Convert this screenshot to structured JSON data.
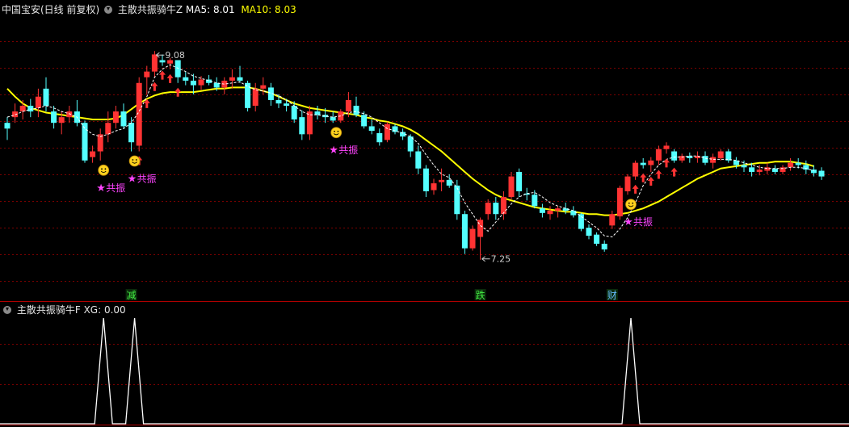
{
  "top_header": {
    "stock": "中国宝安(日线 前复权)",
    "indicator": "主散共振骑牛Z",
    "ma5_label": "MA5: 8.01",
    "ma10_label": "MA10: 8.03"
  },
  "bottom_header": {
    "indicator": "主散共振骑牛F",
    "xg_label": "XG: 0.00"
  },
  "colors": {
    "up": "#ff3333",
    "down": "#54ffff",
    "ma10": "#ffff00",
    "ma5": "#ffffff",
    "signal": "#ff44ff",
    "grid": "#7a0000"
  },
  "chart_data": [
    {
      "type": "candlestick",
      "ohlc": [
        [
          8.45,
          8.5,
          8.3,
          8.4
        ],
        [
          8.5,
          8.62,
          8.45,
          8.55
        ],
        [
          8.55,
          8.65,
          8.48,
          8.6
        ],
        [
          8.6,
          8.66,
          8.5,
          8.55
        ],
        [
          8.58,
          8.75,
          8.5,
          8.68
        ],
        [
          8.75,
          8.85,
          8.55,
          8.6
        ],
        [
          8.55,
          8.6,
          8.4,
          8.45
        ],
        [
          8.45,
          8.55,
          8.35,
          8.5
        ],
        [
          8.5,
          8.6,
          8.45,
          8.55
        ],
        [
          8.55,
          8.65,
          8.42,
          8.45
        ],
        [
          8.45,
          8.47,
          8.1,
          8.12
        ],
        [
          8.15,
          8.25,
          8.1,
          8.2
        ],
        [
          8.2,
          8.4,
          8.12,
          8.35
        ],
        [
          8.35,
          8.55,
          8.28,
          8.45
        ],
        [
          8.45,
          8.6,
          8.4,
          8.55
        ],
        [
          8.55,
          8.62,
          8.4,
          8.42
        ],
        [
          8.45,
          8.5,
          8.2,
          8.28
        ],
        [
          8.25,
          8.85,
          8.2,
          8.8
        ],
        [
          8.85,
          8.95,
          8.7,
          8.9
        ],
        [
          8.9,
          9.08,
          8.85,
          9.05
        ],
        [
          9.0,
          9.05,
          8.95,
          8.98
        ],
        [
          8.97,
          9.02,
          8.92,
          9.0
        ],
        [
          9.0,
          9.0,
          8.8,
          8.85
        ],
        [
          8.85,
          8.9,
          8.78,
          8.82
        ],
        [
          8.82,
          8.88,
          8.7,
          8.78
        ],
        [
          8.78,
          8.86,
          8.74,
          8.83
        ],
        [
          8.83,
          8.87,
          8.78,
          8.8
        ],
        [
          8.8,
          8.85,
          8.73,
          8.76
        ],
        [
          8.76,
          8.85,
          8.7,
          8.82
        ],
        [
          8.82,
          8.92,
          8.75,
          8.85
        ],
        [
          8.85,
          8.95,
          8.8,
          8.82
        ],
        [
          8.8,
          8.82,
          8.55,
          8.58
        ],
        [
          8.6,
          8.8,
          8.55,
          8.75
        ],
        [
          8.75,
          8.85,
          8.7,
          8.78
        ],
        [
          8.76,
          8.8,
          8.6,
          8.65
        ],
        [
          8.65,
          8.7,
          8.58,
          8.62
        ],
        [
          8.62,
          8.66,
          8.55,
          8.6
        ],
        [
          8.6,
          8.64,
          8.45,
          8.48
        ],
        [
          8.5,
          8.56,
          8.3,
          8.35
        ],
        [
          8.35,
          8.6,
          8.3,
          8.55
        ],
        [
          8.55,
          8.6,
          8.48,
          8.52
        ],
        [
          8.52,
          8.58,
          8.45,
          8.5
        ],
        [
          8.5,
          8.55,
          8.45,
          8.47
        ],
        [
          8.47,
          8.57,
          8.45,
          8.55
        ],
        [
          8.55,
          8.72,
          8.5,
          8.65
        ],
        [
          8.6,
          8.68,
          8.5,
          8.52
        ],
        [
          8.52,
          8.55,
          8.4,
          8.42
        ],
        [
          8.42,
          8.48,
          8.35,
          8.38
        ],
        [
          8.36,
          8.4,
          8.25,
          8.28
        ],
        [
          8.3,
          8.46,
          8.28,
          8.44
        ],
        [
          8.42,
          8.44,
          8.35,
          8.37
        ],
        [
          8.37,
          8.4,
          8.3,
          8.33
        ],
        [
          8.33,
          8.35,
          8.15,
          8.2
        ],
        [
          8.2,
          8.25,
          8.0,
          8.05
        ],
        [
          8.05,
          8.08,
          7.8,
          7.85
        ],
        [
          7.86,
          7.96,
          7.82,
          7.92
        ],
        [
          7.93,
          8.05,
          7.85,
          7.95
        ],
        [
          7.95,
          8.0,
          7.88,
          7.9
        ],
        [
          7.9,
          7.95,
          7.6,
          7.65
        ],
        [
          7.65,
          7.68,
          7.3,
          7.35
        ],
        [
          7.35,
          7.55,
          7.33,
          7.52
        ],
        [
          7.45,
          7.62,
          7.25,
          7.6
        ],
        [
          7.65,
          7.78,
          7.6,
          7.75
        ],
        [
          7.75,
          7.8,
          7.6,
          7.65
        ],
        [
          7.65,
          7.85,
          7.6,
          7.8
        ],
        [
          7.8,
          8.02,
          7.78,
          7.98
        ],
        [
          8.02,
          8.05,
          7.8,
          7.85
        ],
        [
          7.83,
          7.88,
          7.77,
          7.82
        ],
        [
          7.82,
          7.86,
          7.7,
          7.72
        ],
        [
          7.7,
          7.74,
          7.62,
          7.66
        ],
        [
          7.65,
          7.72,
          7.6,
          7.68
        ],
        [
          7.68,
          7.72,
          7.62,
          7.7
        ],
        [
          7.7,
          7.75,
          7.65,
          7.68
        ],
        [
          7.68,
          7.72,
          7.62,
          7.64
        ],
        [
          7.65,
          7.66,
          7.5,
          7.52
        ],
        [
          7.53,
          7.56,
          7.43,
          7.46
        ],
        [
          7.47,
          7.49,
          7.37,
          7.39
        ],
        [
          7.39,
          7.42,
          7.32,
          7.34
        ],
        [
          7.55,
          7.68,
          7.52,
          7.65
        ],
        [
          7.63,
          7.9,
          7.6,
          7.88
        ],
        [
          7.85,
          8.0,
          7.82,
          7.98
        ],
        [
          7.98,
          8.12,
          7.95,
          8.1
        ],
        [
          8.1,
          8.14,
          8.05,
          8.08
        ],
        [
          8.08,
          8.15,
          8.02,
          8.12
        ],
        [
          8.12,
          8.25,
          8.08,
          8.22
        ],
        [
          8.22,
          8.28,
          8.18,
          8.25
        ],
        [
          8.2,
          8.22,
          8.1,
          8.12
        ],
        [
          8.12,
          8.18,
          8.1,
          8.16
        ],
        [
          8.16,
          8.19,
          8.1,
          8.14
        ],
        [
          8.14,
          8.2,
          8.1,
          8.16
        ],
        [
          8.16,
          8.2,
          8.08,
          8.1
        ],
        [
          8.1,
          8.18,
          8.05,
          8.15
        ],
        [
          8.14,
          8.22,
          8.12,
          8.2
        ],
        [
          8.2,
          8.22,
          8.1,
          8.12
        ],
        [
          8.12,
          8.15,
          8.05,
          8.08
        ],
        [
          8.08,
          8.12,
          8.02,
          8.06
        ],
        [
          8.06,
          8.1,
          7.98,
          8.02
        ],
        [
          8.02,
          8.08,
          7.99,
          8.04
        ],
        [
          8.03,
          8.1,
          8.0,
          8.06
        ],
        [
          8.05,
          8.08,
          8.0,
          8.02
        ],
        [
          8.02,
          8.08,
          8.0,
          8.06
        ],
        [
          8.06,
          8.14,
          8.03,
          8.1
        ],
        [
          8.1,
          8.14,
          8.05,
          8.08
        ],
        [
          8.08,
          8.12,
          8.0,
          8.04
        ],
        [
          8.04,
          8.08,
          7.98,
          8.01
        ],
        [
          8.03,
          8.06,
          7.95,
          7.98
        ]
      ],
      "ma10": [
        8.75,
        8.68,
        8.62,
        8.58,
        8.56,
        8.54,
        8.53,
        8.52,
        8.51,
        8.5,
        8.49,
        8.48,
        8.48,
        8.48,
        8.49,
        8.52,
        8.57,
        8.62,
        8.66,
        8.69,
        8.71,
        8.72,
        8.72,
        8.72,
        8.72,
        8.73,
        8.74,
        8.75,
        8.75,
        8.76,
        8.76,
        8.76,
        8.75,
        8.73,
        8.71,
        8.68,
        8.65,
        8.62,
        8.6,
        8.58,
        8.57,
        8.56,
        8.55,
        8.54,
        8.53,
        8.52,
        8.5,
        8.49,
        8.47,
        8.46,
        8.44,
        8.42,
        8.39,
        8.35,
        8.3,
        8.25,
        8.2,
        8.14,
        8.08,
        8.02,
        7.96,
        7.91,
        7.86,
        7.82,
        7.79,
        7.77,
        7.75,
        7.73,
        7.71,
        7.7,
        7.69,
        7.68,
        7.67,
        7.67,
        7.66,
        7.65,
        7.65,
        7.64,
        7.64,
        7.65,
        7.66,
        7.68,
        7.7,
        7.73,
        7.76,
        7.8,
        7.84,
        7.88,
        7.92,
        7.96,
        7.99,
        8.02,
        8.05,
        8.06,
        8.07,
        8.08,
        8.09,
        8.1,
        8.1,
        8.11,
        8.11,
        8.11,
        8.1,
        8.09,
        8.07
      ],
      "ma5": [
        8.5,
        8.52,
        8.55,
        8.57,
        8.58,
        8.6,
        8.58,
        8.55,
        8.53,
        8.5,
        8.4,
        8.35,
        8.33,
        8.35,
        8.38,
        8.4,
        8.45,
        8.55,
        8.68,
        8.85,
        8.92,
        8.96,
        8.93,
        8.9,
        8.86,
        8.84,
        8.82,
        8.8,
        8.79,
        8.8,
        8.81,
        8.77,
        8.74,
        8.73,
        8.71,
        8.69,
        8.65,
        8.6,
        8.55,
        8.52,
        8.52,
        8.51,
        8.5,
        8.51,
        8.54,
        8.55,
        8.53,
        8.5,
        8.45,
        8.4,
        8.38,
        8.36,
        8.33,
        8.27,
        8.17,
        8.08,
        8.0,
        7.97,
        7.88,
        7.75,
        7.65,
        7.55,
        7.5,
        7.58,
        7.66,
        7.74,
        7.8,
        7.83,
        7.84,
        7.8,
        7.75,
        7.72,
        7.7,
        7.68,
        7.63,
        7.58,
        7.53,
        7.46,
        7.45,
        7.52,
        7.62,
        7.75,
        7.9,
        8.0,
        8.08,
        8.13,
        8.15,
        8.15,
        8.16,
        8.16,
        8.14,
        8.13,
        8.13,
        8.13,
        8.12,
        8.1,
        8.08,
        8.06,
        8.05,
        8.05,
        8.05,
        8.06,
        8.06,
        8.05,
        8.03
      ],
      "annotations": [
        {
          "index": 19,
          "price": 9.08,
          "text": "9.08"
        },
        {
          "index": 61,
          "price": 7.25,
          "text": "7.25"
        }
      ],
      "signals": [
        {
          "index": 12,
          "text": "共振"
        },
        {
          "index": 16,
          "text": "共振"
        },
        {
          "index": 42,
          "text": "共振"
        },
        {
          "index": 80,
          "text": "共振"
        }
      ],
      "smileys": [
        12,
        16,
        42,
        80
      ],
      "markers": [
        {
          "index": 16,
          "text": "减",
          "color": "#44ee44"
        },
        {
          "index": 61,
          "text": "跌",
          "color": "#44ee44"
        },
        {
          "index": 78,
          "text": "财",
          "color": "#66bbff"
        }
      ],
      "ylim": [
        7.05,
        9.4
      ]
    },
    {
      "type": "line",
      "name": "XG",
      "spikes": [
        12,
        16,
        80
      ],
      "ylim": [
        0,
        1
      ]
    }
  ]
}
